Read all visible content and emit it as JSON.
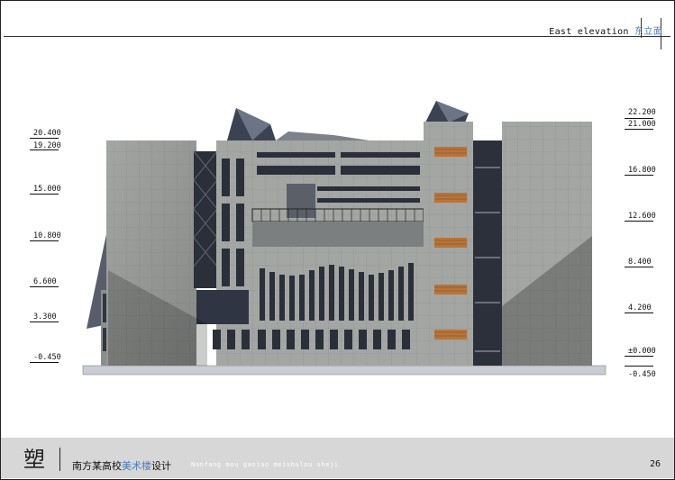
{
  "header": {
    "title_en": "East elevation",
    "title_zh": "东立面"
  },
  "levels_left": [
    "20.400",
    "19.200",
    "15.000",
    "10.800",
    "6.600",
    "3.300",
    "-0.450"
  ],
  "levels_right": [
    "22.200",
    "21.000",
    "16.800",
    "12.600",
    "8.400",
    "4.200",
    "±0.000",
    "-0.450"
  ],
  "footer": {
    "logo_char": "塑",
    "title_part1": "南方某高校",
    "title_part2": "美术楼",
    "title_part3": "设计",
    "pinyin": "Nanfang mou gaoiao meishulou sheji",
    "page_number": "26"
  },
  "colors": {
    "accent_blue": "#4a7cc0",
    "facade_grey": "#9a9e9b",
    "window_dark": "#2a2f3a",
    "wood_louver": "#b8743a",
    "footer_band": "#d7d7d7"
  }
}
